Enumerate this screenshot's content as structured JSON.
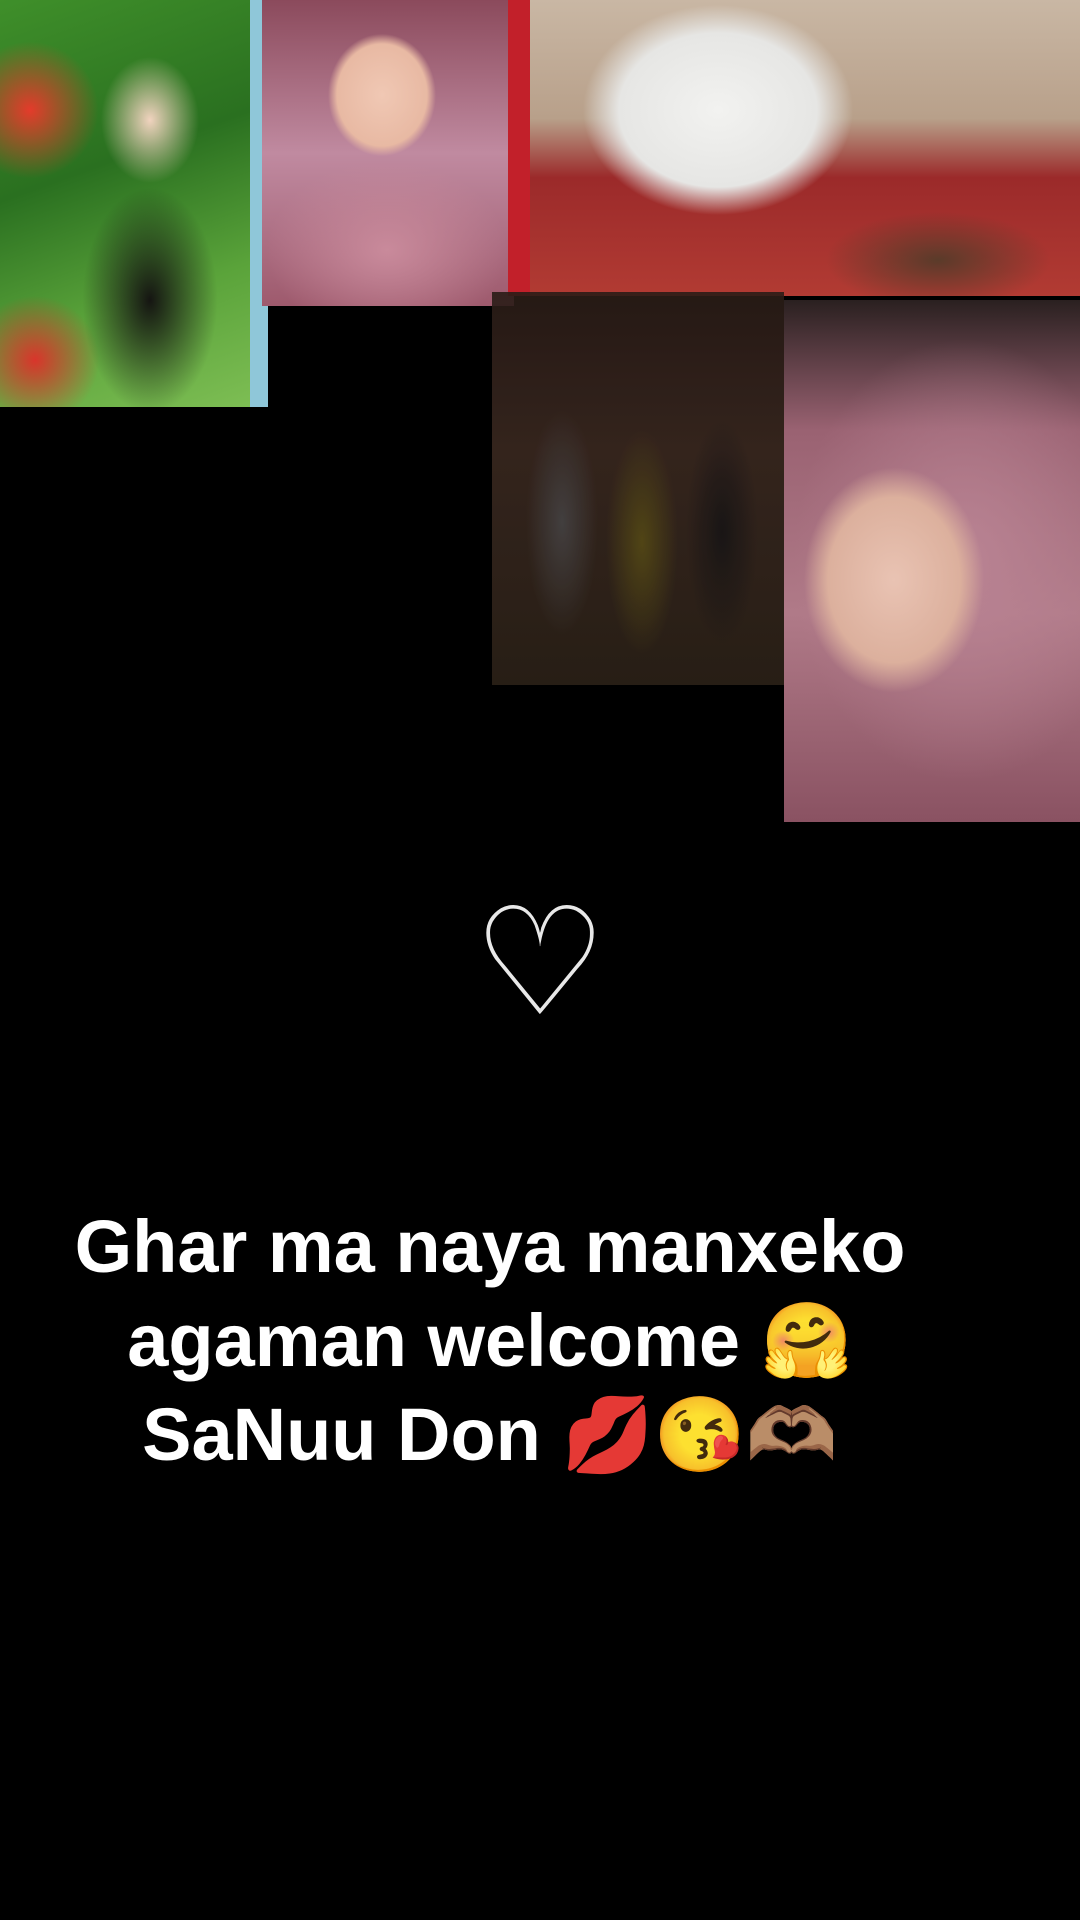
{
  "photos": [
    {
      "name": "couple-photo"
    },
    {
      "name": "baby-photo-top"
    },
    {
      "name": "rug-photo"
    },
    {
      "name": "family-photo"
    },
    {
      "name": "baby-sleeping-photo"
    }
  ],
  "heart_icon": "♡",
  "caption": {
    "lines": [
      "Ghar ma naya manxeko",
      "agaman welcome 🤗",
      "SaNuu Don 💋😘🫶🏽"
    ]
  }
}
